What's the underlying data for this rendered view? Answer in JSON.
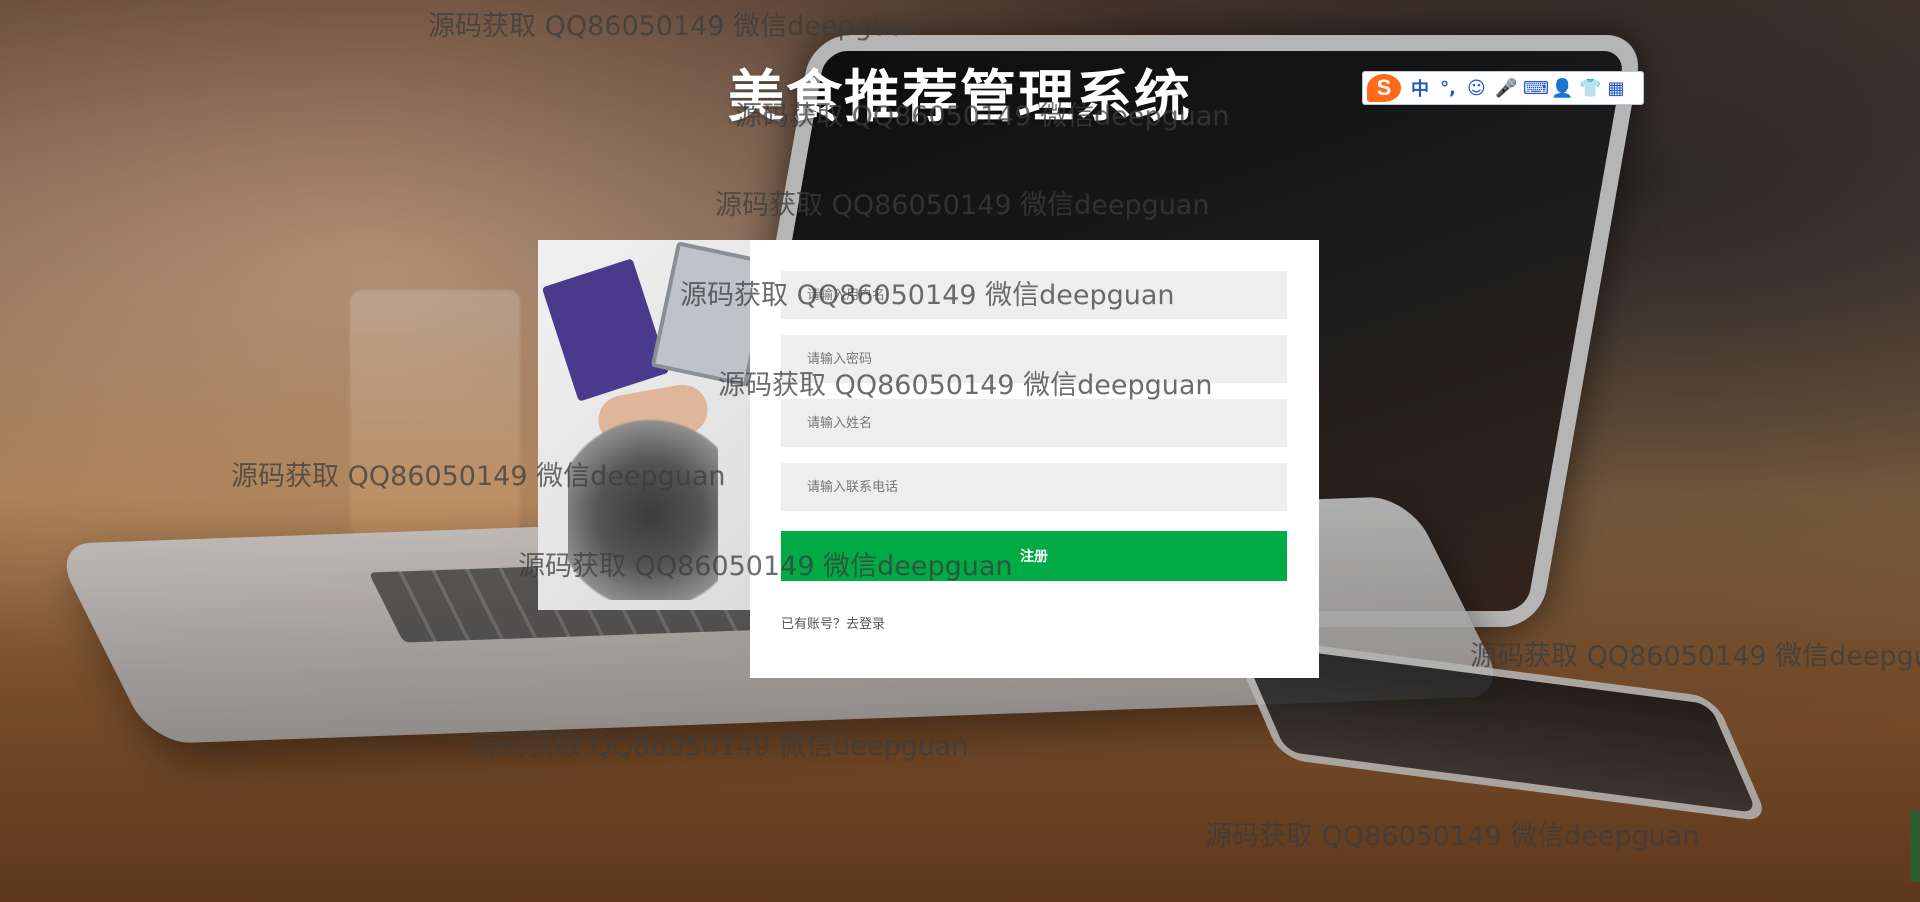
{
  "page": {
    "title": "美食推荐管理系统"
  },
  "form": {
    "username_placeholder": "请输入用户名",
    "password_placeholder": "请输入密码",
    "name_placeholder": "请输入姓名",
    "phone_placeholder": "请输入联系电话",
    "register_label": "注册",
    "login_link": "已有账号？去登录"
  },
  "ime": {
    "items": [
      "中",
      "°,",
      "☺",
      "🎤",
      "⌨",
      "👤",
      "👕",
      "▦"
    ]
  },
  "watermark": {
    "text": "源码获取 QQ86050149 微信deepguan"
  },
  "colors": {
    "primary_button": "#00aa44",
    "panel_background": "#ffffff",
    "input_background": "#eeeeee"
  }
}
